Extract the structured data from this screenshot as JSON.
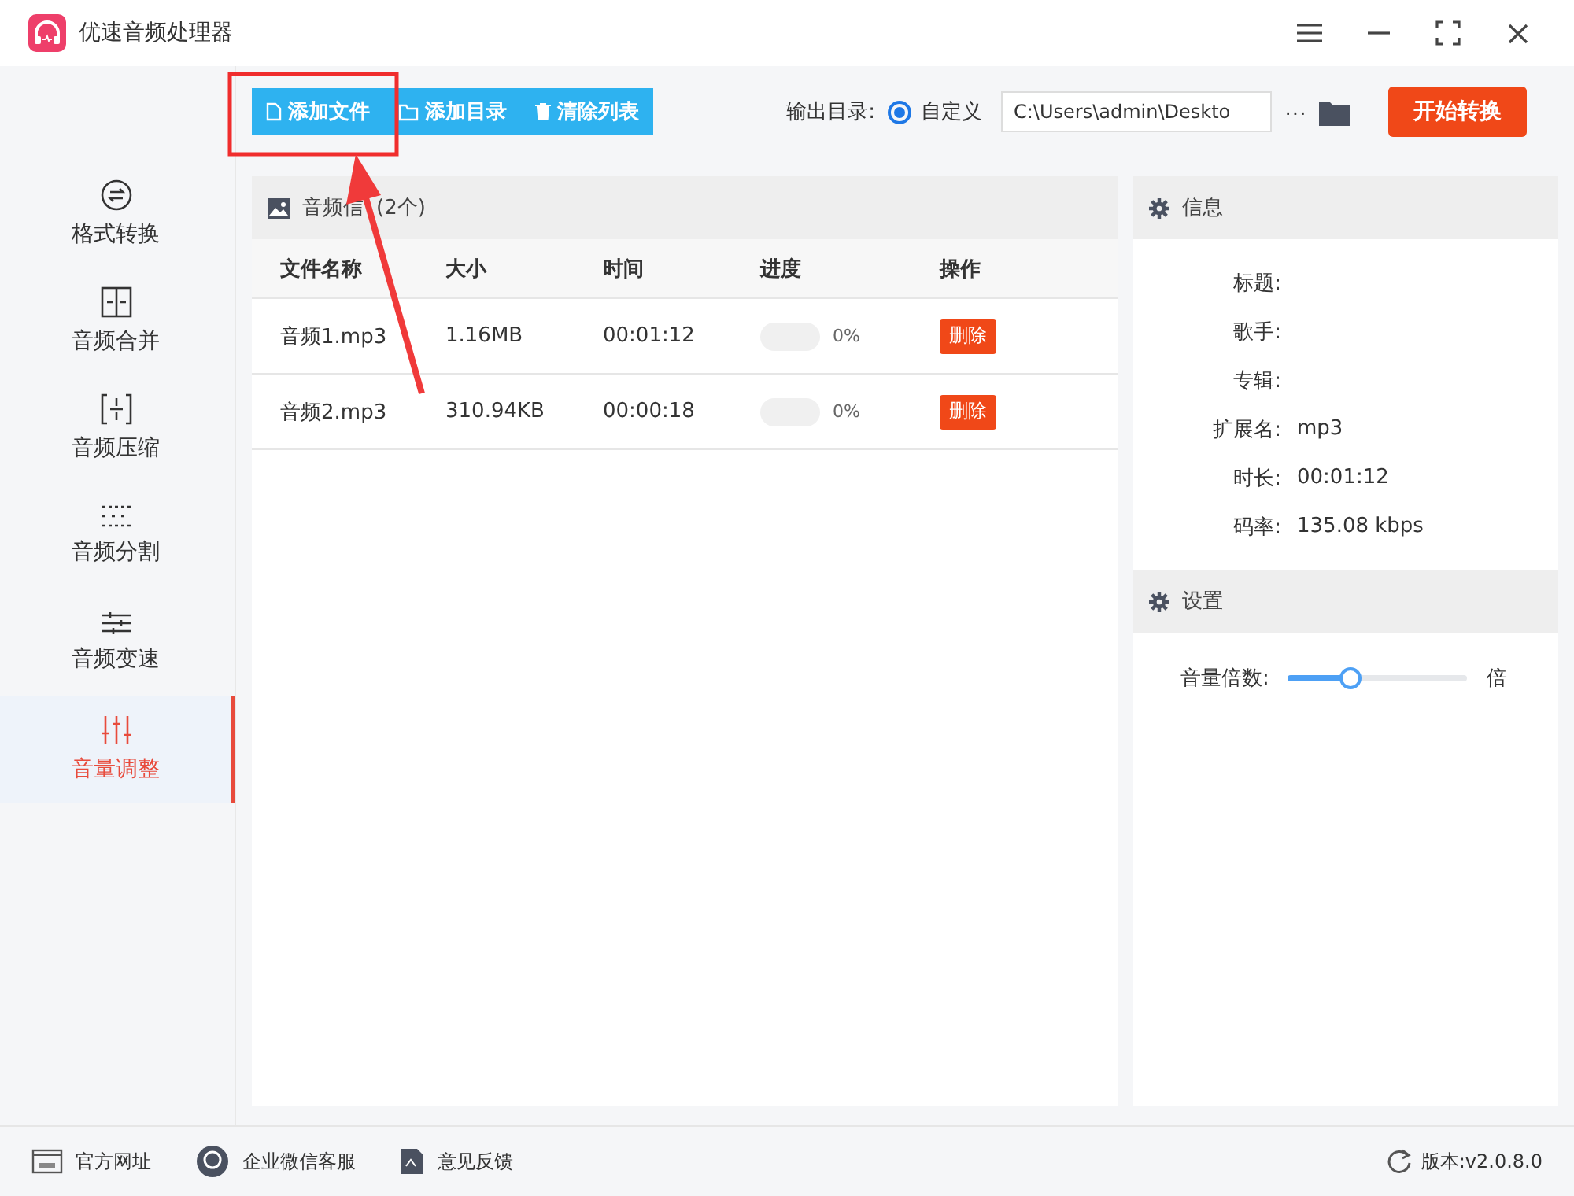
{
  "window": {
    "title": "优速音频处理器"
  },
  "toolbar": {
    "buttons": [
      {
        "kind": "file",
        "label": "添加文件"
      },
      {
        "kind": "folder",
        "label": "添加目录"
      },
      {
        "kind": "trash",
        "label": "清除列表"
      }
    ],
    "output_label": "输出目录:",
    "output_option": {
      "label": "自定义",
      "selected": true
    },
    "output_path": "C:\\Users\\admin\\Deskto",
    "more": "···",
    "start_button": "开始转换"
  },
  "sidebar": {
    "items": [
      {
        "kind": "convert",
        "label": "格式转换",
        "selected": false
      },
      {
        "kind": "merge",
        "label": "音频合并",
        "selected": false
      },
      {
        "kind": "compress",
        "label": "音频压缩",
        "selected": false
      },
      {
        "kind": "split",
        "label": "音频分割",
        "selected": false
      },
      {
        "kind": "speed",
        "label": "音频变速",
        "selected": false
      },
      {
        "kind": "volume",
        "label": "音量调整",
        "selected": true
      }
    ]
  },
  "file_panel": {
    "title": "音频信",
    "count": "(2个)",
    "columns": [
      "文件名称",
      "大小",
      "时间",
      "进度",
      "操作"
    ],
    "rows": [
      {
        "name": "音频1.mp3",
        "size": "1.16MB",
        "time": "00:01:12",
        "progress": {
          "level": 0,
          "reading": "0%"
        },
        "action": "删除"
      },
      {
        "name": "音频2.mp3",
        "size": "310.94KB",
        "time": "00:00:18",
        "progress": {
          "level": 0,
          "reading": "0%"
        },
        "action": "删除"
      }
    ]
  },
  "info_panel": {
    "title": "信息",
    "fields": [
      {
        "label": "标题:"
      },
      {
        "label": "歌手:"
      },
      {
        "label": "专辑:"
      },
      {
        "label": "扩展名:",
        "value": "mp3"
      },
      {
        "label": "时长:",
        "value": "00:01:12"
      },
      {
        "label": "码率:",
        "value": "135.08 kbps"
      }
    ]
  },
  "settings_panel": {
    "title": "设置",
    "volume": {
      "label": "音量倍数:",
      "level": 0.33,
      "unit": "倍"
    }
  },
  "footer": {
    "links": [
      {
        "kind": "web",
        "label": "官方网址"
      },
      {
        "kind": "chat",
        "label": "企业微信客服"
      },
      {
        "kind": "feedback",
        "label": "意见反馈"
      }
    ],
    "version": "版本:v2.0.8.0"
  }
}
